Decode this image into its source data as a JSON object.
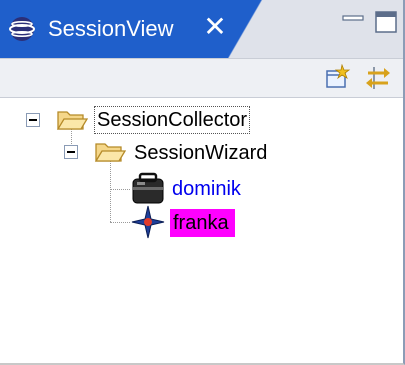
{
  "view": {
    "title": "SessionView",
    "title_icon": "eclipse-view-icon",
    "close_icon": "close-icon",
    "minimize_icon": "minimize-icon",
    "maximize_icon": "maximize-icon"
  },
  "toolbar": {
    "buttons": [
      {
        "icon": "new-session-icon"
      },
      {
        "icon": "sync-arrows-icon"
      }
    ]
  },
  "tree": {
    "root": {
      "label": "SessionCollector",
      "icon": "open-folder-icon",
      "expanded": true,
      "children": [
        {
          "label": "SessionWizard",
          "icon": "open-folder-icon",
          "expanded": true,
          "children": [
            {
              "label": "dominik",
              "icon": "bag-user-icon",
              "color": "#0000ee"
            },
            {
              "label": "franka",
              "icon": "star-user-icon",
              "color": "#000000",
              "highlight": "#ff00ff"
            }
          ]
        }
      ]
    }
  },
  "colors": {
    "tab_active": "#1f5fcb",
    "titlebar_bg": "#dfe2ea",
    "link_blue": "#0000ee",
    "highlight_magenta": "#ff00ff"
  }
}
